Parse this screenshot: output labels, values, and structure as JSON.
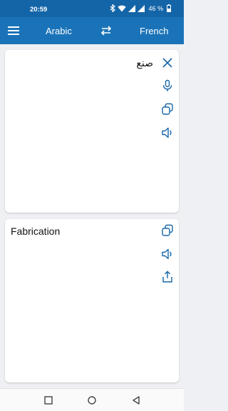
{
  "status_bar": {
    "time": "20:59",
    "battery": "46 %"
  },
  "app_bar": {
    "source_language": "Arabic",
    "target_language": "French"
  },
  "input": {
    "text": "صنع"
  },
  "output": {
    "text": "Fabrication"
  },
  "icons": {
    "menu": "menu-icon",
    "swap": "swap-icon",
    "clear": "close-icon",
    "mic": "microphone-icon",
    "copy": "copy-icon",
    "speak": "speaker-icon",
    "share": "share-icon"
  },
  "colors": {
    "primary": "#1a73b8",
    "status": "#1465a8",
    "icon": "#1565a8"
  }
}
